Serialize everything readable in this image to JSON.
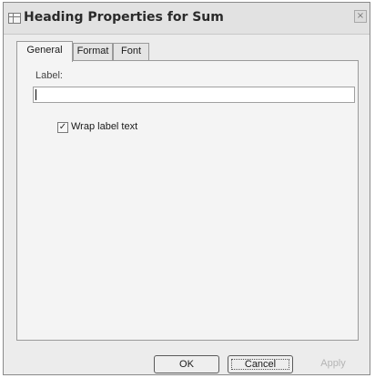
{
  "window": {
    "title": "Heading Properties for Sum",
    "close_glyph": "×"
  },
  "tabs": [
    {
      "label": "General",
      "active": true
    },
    {
      "label": "Format",
      "active": false
    },
    {
      "label": "Font",
      "active": false
    }
  ],
  "general": {
    "label_caption": "Label:",
    "label_value": "",
    "wrap_label_text": {
      "label": "Wrap label text",
      "checked": true,
      "check_glyph": "✓"
    }
  },
  "buttons": {
    "ok": "OK",
    "cancel": "Cancel",
    "apply": "Apply"
  }
}
